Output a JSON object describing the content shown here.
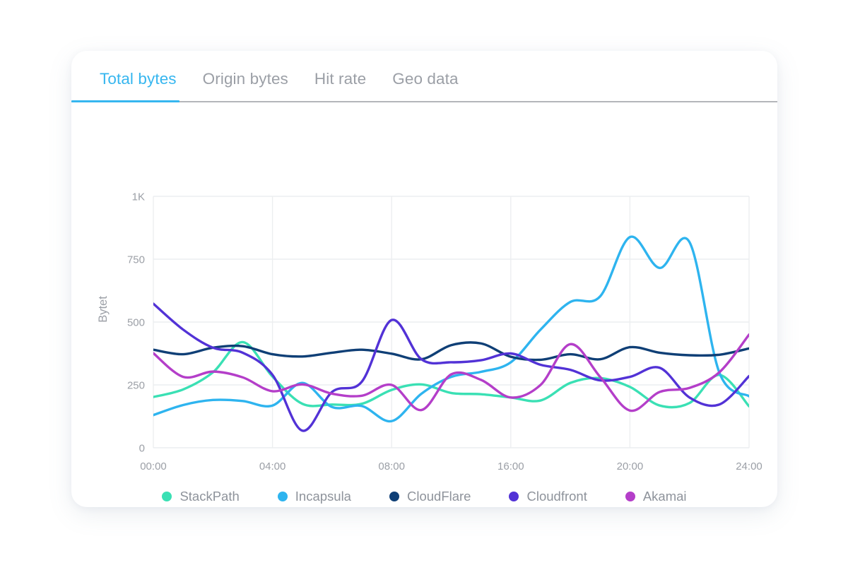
{
  "card": {
    "tabs": [
      {
        "label": "Total bytes",
        "active": true
      },
      {
        "label": "Origin bytes",
        "active": false
      },
      {
        "label": "Hit rate",
        "active": false
      },
      {
        "label": "Geo data",
        "active": false
      }
    ],
    "accent_color": "#36b6ef",
    "inactive_tab_color": "#9b9fa6"
  },
  "legend": {
    "items": [
      {
        "label": "StackPath",
        "color": "#3ae0b4"
      },
      {
        "label": "Incapsula",
        "color": "#2eb4ef"
      },
      {
        "label": "CloudFlare",
        "color": "#0f3f76"
      },
      {
        "label": "Cloudfront",
        "color": "#5232d6"
      },
      {
        "label": "Akamai",
        "color": "#b43ec9"
      }
    ]
  },
  "chart_data": {
    "type": "line",
    "title": "",
    "xlabel": "",
    "ylabel": "Bytet",
    "ylim": [
      0,
      1000
    ],
    "ytick_values": [
      0,
      250,
      500,
      750,
      1000
    ],
    "ytick_labels": [
      "0",
      "250",
      "500",
      "750",
      "1K"
    ],
    "xtick_labels": [
      "00:00",
      "04:00",
      "08:00",
      "16:00",
      "20:00",
      "24:00"
    ],
    "xtick_positions": [
      0,
      4,
      8,
      12,
      16,
      20
    ],
    "x_range": [
      0,
      20
    ],
    "grid": {
      "horizontal": true,
      "vertical": true,
      "color": "#eceef0"
    },
    "legend_position": "bottom-center",
    "smoothing": "cardinal-spline",
    "line_width": 3.4,
    "x": [
      0,
      1,
      2,
      3,
      4,
      5,
      6,
      7,
      8,
      9,
      10,
      11,
      12,
      13,
      14,
      15,
      16,
      17,
      18,
      19,
      20
    ],
    "series": [
      {
        "name": "StackPath",
        "color": "#3ae0b4",
        "values": [
          202,
          232,
          300,
          420,
          283,
          175,
          172,
          175,
          230,
          252,
          218,
          213,
          200,
          188,
          258,
          277,
          242,
          168,
          178,
          290,
          165
        ]
      },
      {
        "name": "Incapsula",
        "color": "#2eb4ef",
        "values": [
          130,
          170,
          190,
          186,
          168,
          258,
          162,
          166,
          106,
          215,
          282,
          302,
          340,
          470,
          580,
          602,
          838,
          715,
          818,
          300,
          205
        ]
      },
      {
        "name": "CloudFlare",
        "color": "#0f3f76",
        "values": [
          390,
          372,
          398,
          404,
          372,
          363,
          378,
          390,
          374,
          352,
          408,
          415,
          362,
          350,
          372,
          352,
          400,
          378,
          368,
          370,
          395
        ]
      },
      {
        "name": "Cloudfront",
        "color": "#5232d6",
        "values": [
          573,
          470,
          398,
          378,
          290,
          68,
          222,
          263,
          508,
          352,
          340,
          348,
          375,
          330,
          310,
          268,
          282,
          318,
          200,
          172,
          285
        ]
      },
      {
        "name": "Akamai",
        "color": "#b43ec9",
        "values": [
          376,
          282,
          303,
          280,
          225,
          252,
          215,
          207,
          250,
          150,
          292,
          270,
          200,
          250,
          412,
          282,
          148,
          222,
          238,
          300,
          450
        ]
      }
    ]
  }
}
